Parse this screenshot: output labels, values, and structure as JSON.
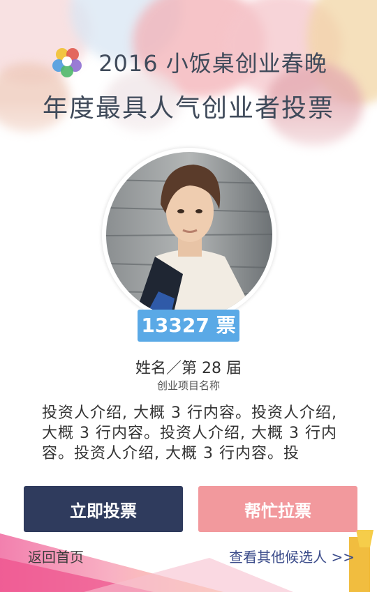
{
  "header": {
    "year_title": "2016 小饭桌创业春晚",
    "subtitle": "年度最具人气创业者投票"
  },
  "candidate": {
    "votes": "13327 票",
    "name_line": "姓名／第 28 届",
    "project": "创业项目名称",
    "intro": "投资人介绍, 大概 3 行内容。投资人介绍, 大概 3 行内容。投资人介绍, 大概 3 行内容。投资人介绍, 大概 3 行内容。投"
  },
  "actions": {
    "vote_label": "立即投票",
    "help_label": "帮忙拉票"
  },
  "footer": {
    "home_label": "返回首页",
    "others_label": "查看其他候选人 >>"
  },
  "colors": {
    "vote_button": "#2f3b5d",
    "help_button": "#f2999d",
    "votes_badge": "#5aa9e6"
  }
}
